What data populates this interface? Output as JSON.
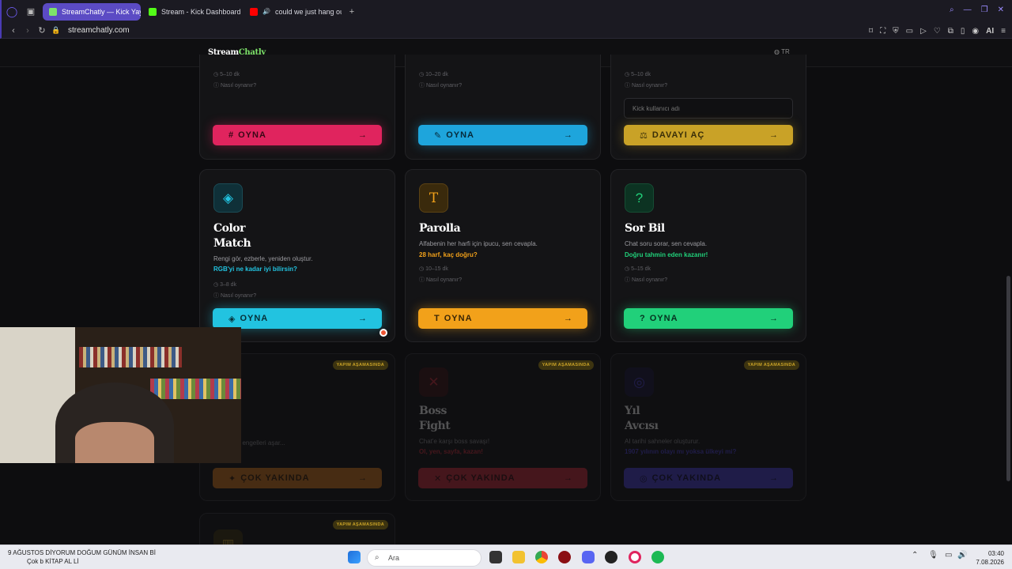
{
  "browser": {
    "tabs": [
      {
        "title": "StreamChatly — Kick Yayın",
        "active": true,
        "color": "#7ee36a"
      },
      {
        "title": "Stream - Kick Dashboard",
        "active": false,
        "color": "#53fc18"
      },
      {
        "title": "could we just hang out",
        "active": false,
        "color": "#ff0000"
      }
    ],
    "url": "streamchatly.com"
  },
  "site": {
    "logo_stream": "Stream",
    "logo_chatly": "Chatly",
    "lang": "TR"
  },
  "top_cards": [
    {
      "duration": "5–10 dk",
      "howto": "Nasıl oynanır?",
      "button": "OYNA",
      "button_color": "#e0245e"
    },
    {
      "duration": "10–20 dk",
      "howto": "Nasıl oynanır?",
      "button": "OYNA",
      "button_color": "#1ea5dc"
    },
    {
      "duration": "5–10 dk",
      "howto": "Nasıl oynanır?",
      "input_placeholder": "Kick kullanıcı adı",
      "button": "DAVAYI AÇ",
      "button_color": "#c9a227"
    }
  ],
  "games": [
    {
      "title_line1": "Color",
      "title_line2": "Match",
      "desc": "Rengi gör, ezberle, yeniden oluştur.",
      "highlight": "RGB'yi ne kadar iyi bilirsin?",
      "duration": "3–8 dk",
      "howto": "Nasıl oynanır?",
      "button": "OYNA",
      "color": "#22c3e0",
      "icon": "droplets-icon"
    },
    {
      "title_line1": "Parolla",
      "title_line2": "",
      "desc": "Alfabenin her harfi için ipucu, sen cevapla.",
      "highlight": "28 harf, kaç doğru?",
      "duration": "10–15 dk",
      "howto": "Nasıl oynanır?",
      "button": "OYNA",
      "color": "#f2a11a",
      "icon": "letter-t-icon"
    },
    {
      "title_line1": "Sor Bil",
      "title_line2": "",
      "desc": "Chat soru sorar, sen cevapla.",
      "highlight": "Doğru tahmin eden kazanır!",
      "duration": "5–15 dk",
      "howto": "Nasıl oynanır?",
      "button": "OYNA",
      "color": "#21d07a",
      "icon": "question-bubble-icon"
    }
  ],
  "upcoming": [
    {
      "badge": "YAPIM AŞAMASINDA",
      "title_line1": "",
      "title_line2": "",
      "desc": "... kelime, engelleri aşar...",
      "highlight": "",
      "button": "ÇOK YAKINDA",
      "color": "#d9781a"
    },
    {
      "badge": "YAPIM AŞAMASINDA",
      "title_line1": "Boss",
      "title_line2": "Fight",
      "desc": "Chat'e karşı boss savaşı!",
      "highlight": "Ol, yen, sayfa, kazan!",
      "button": "ÇOK YAKINDA",
      "color": "#d02a3a"
    },
    {
      "badge": "YAPIM AŞAMASINDA",
      "title_line1": "Yıl",
      "title_line2": "Avcısı",
      "desc": "AI tarihi sahneler oluşturur.",
      "highlight": "1907 yılının olayı mı yoksa ülkeyi mi?",
      "button": "ÇOK YAKINDA",
      "color": "#4b3fd8"
    }
  ],
  "extra_badge": "YAPIM AŞAMASINDA",
  "taskbar": {
    "ticker_line1": "9 AĞUSTOS DİYORUM DOĞUM GÜNÜM İNSAN Bİ",
    "ticker_line2": "KİTAP AL Lİ",
    "ticker_user": "Çok b",
    "search_label": "Ara",
    "time": "03:40",
    "date": "7.08.2026"
  }
}
